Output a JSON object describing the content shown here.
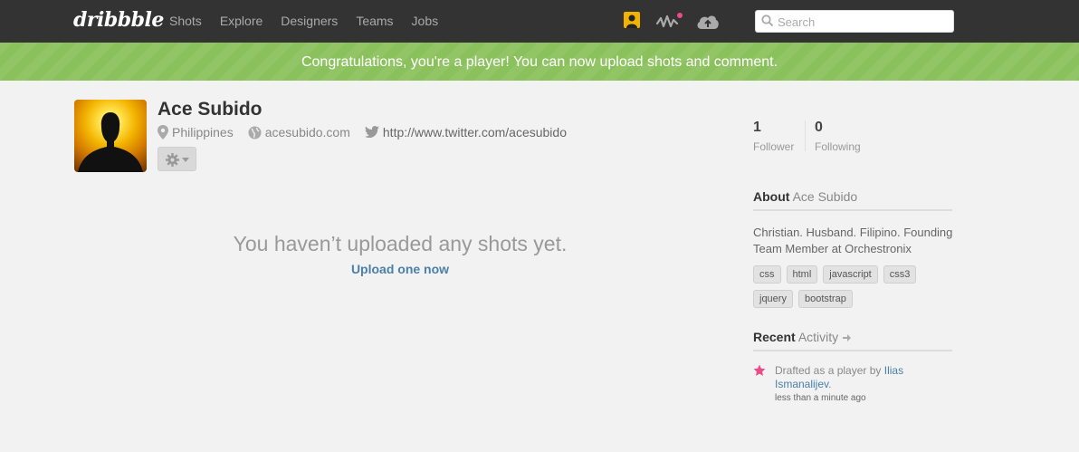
{
  "topbar": {
    "logo": "dribbble",
    "nav": [
      "Shots",
      "Explore",
      "Designers",
      "Teams",
      "Jobs"
    ],
    "icons": [
      "user-avatar-icon",
      "activity-icon",
      "upload-cloud-icon"
    ],
    "search_placeholder": "Search"
  },
  "banner": {
    "text": "Congratulations, you're a player! You can now upload shots and comment."
  },
  "profile": {
    "name": "Ace Subido",
    "location": "Philippines",
    "website": "acesubido.com",
    "twitter": "http://www.twitter.com/acesubido"
  },
  "main": {
    "empty_title": "You haven’t uploaded any shots yet.",
    "upload_link": "Upload one now"
  },
  "sidebar": {
    "followers": {
      "count": "1",
      "label": "Follower"
    },
    "following": {
      "count": "0",
      "label": "Following"
    },
    "about_bold": "About",
    "about_name": "Ace Subido",
    "bio": "Christian. Husband. Filipino. Founding Team Member at Orchestronix",
    "tags": [
      "css",
      "html",
      "javascript",
      "css3",
      "jquery",
      "bootstrap"
    ],
    "recent_bold": "Recent",
    "recent_light": "Activity",
    "activity": {
      "prefix": "Drafted as a player by",
      "user": "Ilias Ismanalijev",
      "suffix": ".",
      "time": "less than a minute ago"
    }
  },
  "colors": {
    "topbar": "#333333",
    "banner": "#8bc15d",
    "link": "#4a7fa8",
    "pink": "#ea4c89"
  }
}
